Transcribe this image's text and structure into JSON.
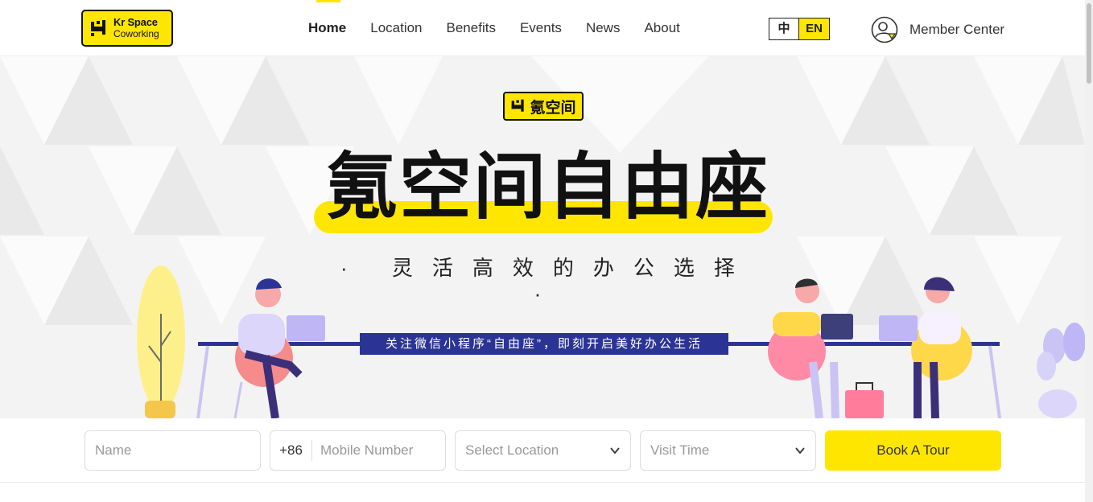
{
  "header": {
    "logo": {
      "line1": "Kr Space",
      "line2": "Coworking"
    },
    "nav": [
      {
        "label": "Home",
        "active": true
      },
      {
        "label": "Location",
        "active": false
      },
      {
        "label": "Benefits",
        "active": false
      },
      {
        "label": "Events",
        "active": false
      },
      {
        "label": "News",
        "active": false
      },
      {
        "label": "About",
        "active": false
      }
    ],
    "lang": {
      "zh": "中",
      "en": "EN",
      "selected": "EN"
    },
    "member_label": "Member Center"
  },
  "banner": {
    "badge_text": "氪空间",
    "title": "氪空间自由座",
    "subtitle": "· 灵活高效的办公选择 ·",
    "ribbon": "关注微信小程序“自由座”，即刻开启美好办公生活"
  },
  "form": {
    "name_placeholder": "Name",
    "country_code": "+86",
    "mobile_placeholder": "Mobile Number",
    "location_placeholder": "Select Location",
    "time_placeholder": "Visit Time",
    "book_label": "Book A Tour"
  },
  "colors": {
    "brand_yellow": "#ffe600",
    "ribbon_navy": "#2b3494"
  },
  "icons": [
    "user-icon",
    "chevron-down-icon",
    "chair-logo-icon"
  ]
}
